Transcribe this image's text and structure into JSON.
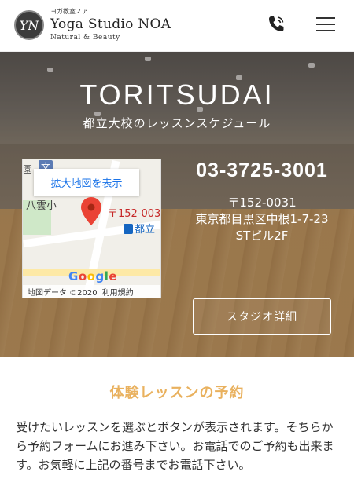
{
  "header": {
    "logo_mark": "YN",
    "logo_sub": "ヨガ教室ノア",
    "logo_main": "Yoga Studio NOA",
    "logo_tag": "Natural & Beauty",
    "phone_icon": "phone-icon",
    "menu_icon": "hamburger-menu-icon"
  },
  "hero": {
    "title": "TORITSUDAI",
    "subtitle": "都立大校のレッスンスケジュール",
    "map": {
      "expand_label": "拡大地図を表示",
      "postal_label": "〒152-003",
      "station_label": "都立",
      "place_label": "八雲小",
      "school_label": "文",
      "school2_label": "園",
      "logo": [
        "G",
        "o",
        "o",
        "g",
        "l",
        "e"
      ],
      "credits": "地図データ ©2020",
      "terms": "利用規約"
    },
    "tel": "03-3725-3001",
    "address_postal": "〒152-0031",
    "address_line1": "東京都目黒区中根1-7-23",
    "address_line2": "STビル2F",
    "detail_button": "スタジオ詳細"
  },
  "booking": {
    "title": "体験レッスンの予約",
    "body": "受けたいレッスンを選ぶとボタンが表示されます。そちらから予約フォームにお進み下さい。お電話でのご予約も出来ます。お気軽に上記の番号までお電話下さい。"
  },
  "colors": {
    "accent": "#e9b15e",
    "map_link": "#1a73e8"
  }
}
